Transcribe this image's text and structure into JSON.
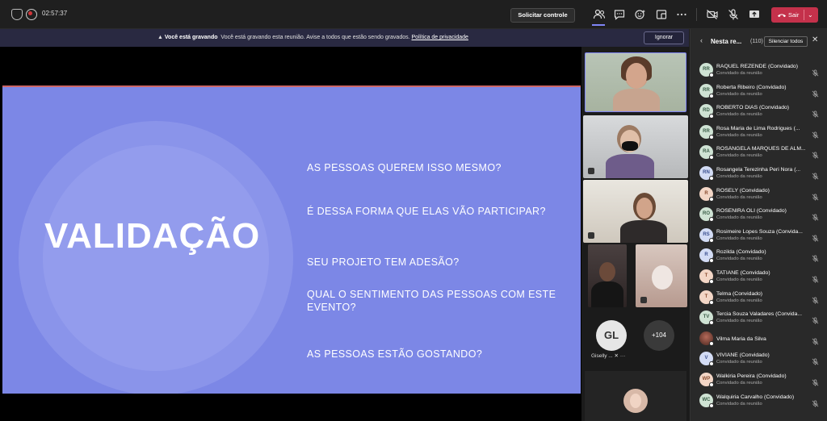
{
  "topbar": {
    "timer": "02:57:37",
    "request_control": "Solicitar controle",
    "leave_label": "Sair"
  },
  "banner": {
    "bold": "Você está gravando",
    "text": "Você está gravando esta reunião. Avise a todos que estão sendo gravados.",
    "link": "Política de privacidade",
    "ignore": "Ignorar"
  },
  "slide": {
    "title": "VALIDAÇÃO",
    "questions": [
      "AS PESSOAS QUEREM ISSO MESMO?",
      "É DESSA FORMA QUE ELAS VÃO PARTICIPAR?",
      "SEU PROJETO TEM ADESÃO?",
      "QUAL O SENTIMENTO DAS PESSOAS COM ESTE EVENTO?",
      "AS PESSOAS ESTÃO GOSTANDO?"
    ]
  },
  "video": {
    "gl_initials": "GL",
    "gl_name": "Giselly ...",
    "more_count": "+104"
  },
  "panel": {
    "title": "Nesta re...",
    "count": "(110)",
    "mute_all": "Silenciar todos",
    "participants": [
      {
        "initials": "RR",
        "name": "RAQUEL REZENDE (Convidado)",
        "role": "Convidado da reunião",
        "color": "green"
      },
      {
        "initials": "RR",
        "name": "Roberta Ribeiro (Convidado)",
        "role": "Convidado da reunião",
        "color": "green"
      },
      {
        "initials": "RD",
        "name": "ROBERTO DIAS (Convidado)",
        "role": "Convidado da reunião",
        "color": "green"
      },
      {
        "initials": "RR",
        "name": "Rosa Maria de Lima Rodrigues (...",
        "role": "Convidado da reunião",
        "color": "green"
      },
      {
        "initials": "RA",
        "name": "ROSÂNGELA MARQUES DE ALM...",
        "role": "Convidado da reunião",
        "color": "green"
      },
      {
        "initials": "RN",
        "name": "Rosangela Terezinha Peri Nora (...",
        "role": "Convidado da reunião",
        "color": "blue"
      },
      {
        "initials": "R",
        "name": "ROSELY (Convidado)",
        "role": "Convidado da reunião",
        "color": "peach"
      },
      {
        "initials": "RO",
        "name": "ROSENIRA OLI (Convidado)",
        "role": "Convidado da reunião",
        "color": "green"
      },
      {
        "initials": "RS",
        "name": "Rosimeire Lopes Souza (Convida...",
        "role": "Convidado da reunião",
        "color": "blue"
      },
      {
        "initials": "R",
        "name": "Rozilda (Convidado)",
        "role": "Convidado da reunião",
        "color": "blue"
      },
      {
        "initials": "T",
        "name": "TATIANE (Convidado)",
        "role": "Convidado da reunião",
        "color": "peach"
      },
      {
        "initials": "T",
        "name": "Telma (Convidado)",
        "role": "Convidado da reunião",
        "color": "peach"
      },
      {
        "initials": "TV",
        "name": "Tercia Souza Valadares (Convida...",
        "role": "Convidado da reunião",
        "color": "green"
      },
      {
        "initials": "",
        "name": "Vilma Maria da Silva",
        "role": "",
        "color": "photo"
      },
      {
        "initials": "V",
        "name": "VIVIANE (Convidado)",
        "role": "Convidado da reunião",
        "color": "blue"
      },
      {
        "initials": "WP",
        "name": "Walkiria Pereira (Convidado)",
        "role": "Convidado da reunião",
        "color": "peach"
      },
      {
        "initials": "WC",
        "name": "Walquiria Carvalho (Convidado)",
        "role": "Convidado da reunião",
        "color": "green"
      }
    ]
  },
  "colors": {
    "accent": "#7f85f5",
    "leave": "#c4314b",
    "slide_bg": "#7c87e6",
    "banner_bg": "#292941"
  }
}
